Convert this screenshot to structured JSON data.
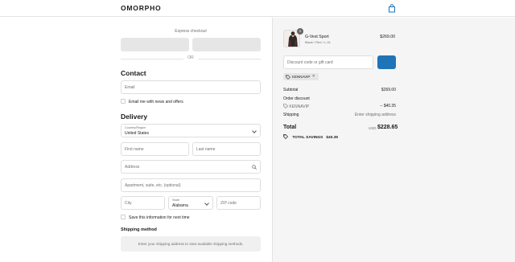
{
  "header": {
    "logo": "OMORPHO",
    "cart_icon": "shopping-bag-icon"
  },
  "express": {
    "label": "Express checkout",
    "or_text": "OR"
  },
  "contact": {
    "title": "Contact",
    "email_placeholder": "Email",
    "newsletter_label": "Email me with news and offers"
  },
  "delivery": {
    "title": "Delivery",
    "country_label": "Country/Region",
    "country_value": "United States",
    "first_name_placeholder": "First name",
    "last_name_placeholder": "Last name",
    "address_placeholder": "Address",
    "apartment_placeholder": "Apartment, suite, etc. (optional)",
    "city_placeholder": "City",
    "state_label": "State",
    "state_value": "Alabama",
    "zip_placeholder": "ZIP code",
    "save_info_label": "Save this information for next time"
  },
  "shipping_method": {
    "title": "Shipping method",
    "message": "Enter your shipping address to view available shipping methods."
  },
  "summary": {
    "product": {
      "quantity": "1",
      "name": "G-Vest Sport",
      "variant": "Black / Red / L-XL",
      "price": "$269.00"
    },
    "discount_placeholder": "Discount code or gift card",
    "applied_code": "KENNAVIP",
    "subtotal_label": "Subtotal",
    "subtotal_value": "$269.00",
    "order_discount_label": "Order discount",
    "discount_code": "KENNAVIP",
    "discount_value": "– $40.35",
    "shipping_label": "Shipping",
    "shipping_value": "Enter shipping address",
    "total_label": "Total",
    "total_currency": "USD",
    "total_value": "$228.65",
    "savings_label": "TOTAL SAVINGS",
    "savings_value": "$40.35"
  },
  "colors": {
    "accent": "#1f73b7",
    "panel_bg": "#f5f5f5",
    "express_btn": "#e6e6e6"
  }
}
